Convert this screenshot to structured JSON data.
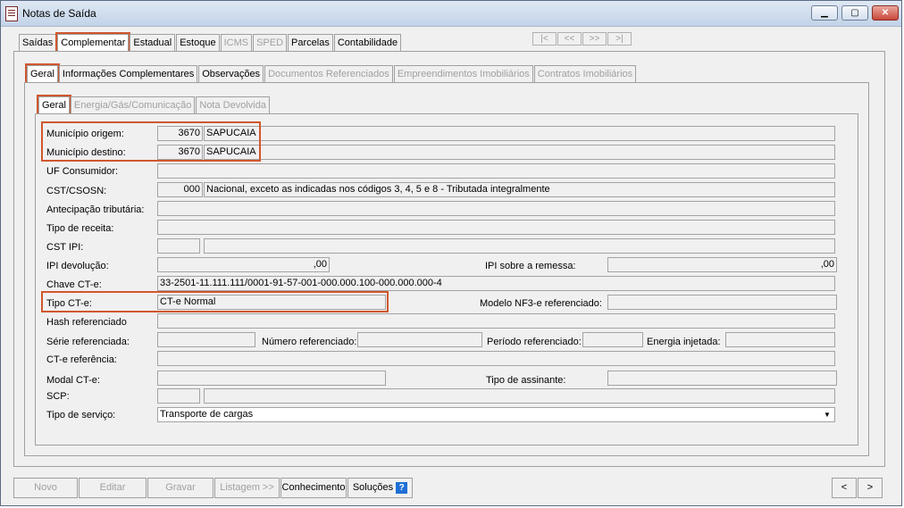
{
  "window": {
    "title": "Notas de Saída",
    "minimize": "▁",
    "maximize": "▢",
    "close": "✕"
  },
  "main_tabs": [
    "Saídas",
    "Complementar",
    "Estadual",
    "Estoque",
    "ICMS",
    "SPED",
    "Parcelas",
    "Contabilidade"
  ],
  "record_nav": [
    "|<",
    "<<",
    ">>",
    ">|"
  ],
  "sub_tabs": [
    "Geral",
    "Informações Complementares",
    "Observações",
    "Documentos Referenciados",
    "Empreendimentos Imobiliários",
    "Contratos Imobiliários"
  ],
  "inner_tabs": [
    "Geral",
    "Energia/Gás/Comunicação",
    "Nota Devolvida"
  ],
  "form": {
    "municipio_origem": {
      "label": "Município origem:",
      "code": "3670",
      "name": "SAPUCAIA"
    },
    "municipio_destino": {
      "label": "Município destino:",
      "code": "3670",
      "name": "SAPUCAIA"
    },
    "uf_consumidor": {
      "label": "UF Consumidor:"
    },
    "cst_csosn": {
      "label": "CST/CSOSN:",
      "code": "000",
      "desc": "Nacional, exceto as indicadas nos códigos 3, 4, 5 e 8 - Tributada integralmente"
    },
    "antecipacao": {
      "label": "Antecipação tributária:"
    },
    "tipo_receita": {
      "label": "Tipo de receita:"
    },
    "cst_ipi": {
      "label": "CST IPI:"
    },
    "ipi_devolucao": {
      "label": "IPI devolução:",
      "value": ",00"
    },
    "ipi_remessa": {
      "label": "IPI sobre a remessa:",
      "value": ",00"
    },
    "chave_cte": {
      "label": "Chave CT-e:",
      "value": "33-2501-11.111.111/0001-91-57-001-000.000.100-000.000.000-4"
    },
    "tipo_cte": {
      "label": "Tipo CT-e:",
      "value": "CT-e Normal"
    },
    "modelo_nf3e": {
      "label": "Modelo NF3-e referenciado:"
    },
    "hash_ref": {
      "label": "Hash referenciado"
    },
    "serie_ref": {
      "label": "Série referenciada:"
    },
    "numero_ref": {
      "label": "Número referenciado:"
    },
    "periodo_ref": {
      "label": "Período referenciado:"
    },
    "energia_injetada": {
      "label": "Energia injetada:"
    },
    "cte_referencia": {
      "label": "CT-e referência:"
    },
    "modal_cte": {
      "label": "Modal CT-e:"
    },
    "tipo_assinante": {
      "label": "Tipo de assinante:"
    },
    "scp": {
      "label": "SCP:"
    },
    "tipo_servico": {
      "label": "Tipo de serviço:",
      "value": "Transporte de cargas"
    }
  },
  "bottom": {
    "novo": "Novo",
    "editar": "Editar",
    "gravar": "Gravar",
    "listagem": "Listagem >>",
    "conhecimento": "Conhecimento",
    "solucoes": "Soluções",
    "help": "?",
    "prev": "<",
    "next": ">"
  },
  "colors": {
    "highlight": "#d0572e",
    "titlebar": "#c3d3e8"
  }
}
